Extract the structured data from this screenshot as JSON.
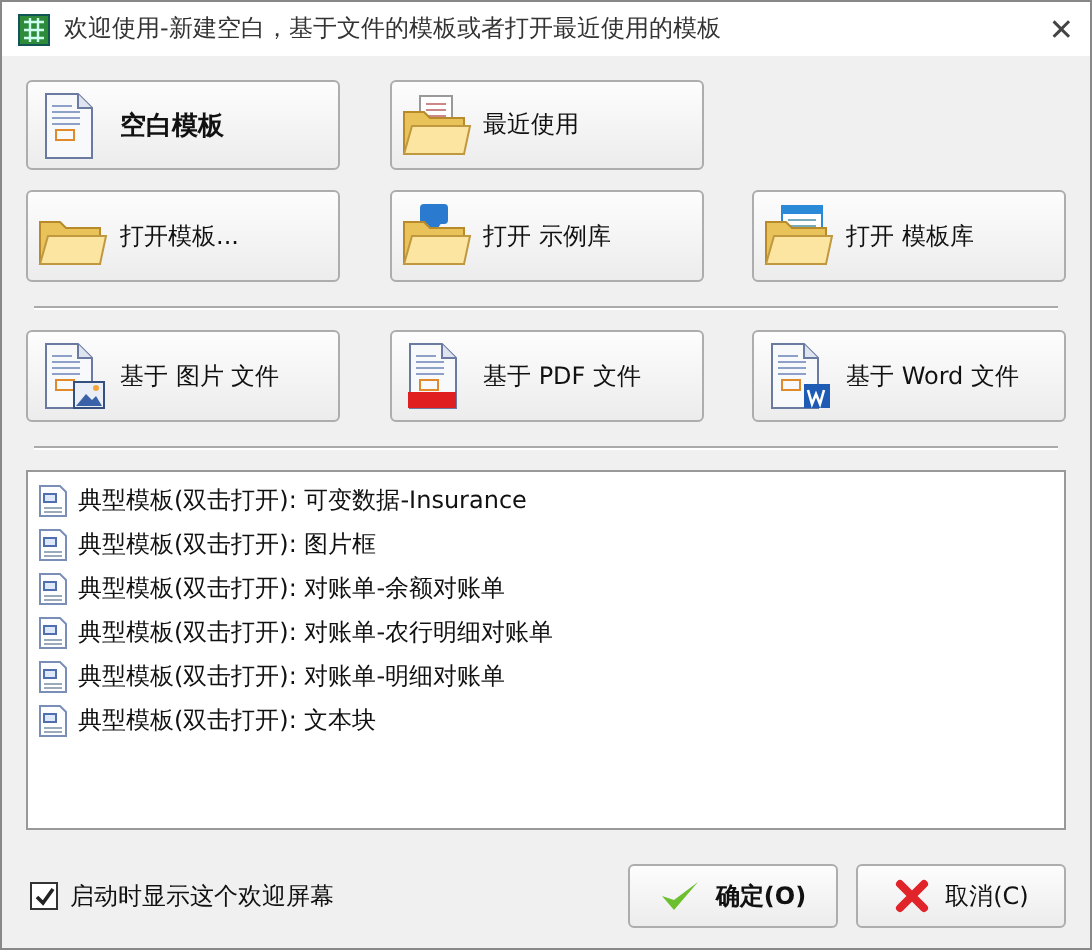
{
  "window": {
    "title": "欢迎使用-新建空白，基于文件的模板或者打开最近使用的模板",
    "close": "✕"
  },
  "button_rows": [
    [
      {
        "label": "空白模板",
        "kind": "blank"
      },
      {
        "label": "最近使用",
        "kind": "recent"
      }
    ],
    [
      {
        "label": "打开模板...",
        "kind": "open"
      },
      {
        "label": "打开 示例库",
        "kind": "samples"
      },
      {
        "label": "打开 模板库",
        "kind": "library"
      }
    ],
    [
      {
        "label": "基于 图片 文件",
        "kind": "image"
      },
      {
        "label": "基于 PDF 文件",
        "kind": "pdf"
      },
      {
        "label": "基于 Word 文件",
        "kind": "word"
      }
    ]
  ],
  "templates": [
    {
      "label": "典型模板(双击打开): 可变数据-Insurance"
    },
    {
      "label": "典型模板(双击打开): 图片框"
    },
    {
      "label": "典型模板(双击打开): 对账单-余额对账单"
    },
    {
      "label": "典型模板(双击打开): 对账单-农行明细对账单"
    },
    {
      "label": "典型模板(双击打开): 对账单-明细对账单"
    },
    {
      "label": "典型模板(双击打开): 文本块"
    }
  ],
  "show_on_startup": {
    "label": "启动时显示这个欢迎屏幕",
    "checked": true
  },
  "buttons": [
    {
      "label": "确定(O)",
      "kind": "ok"
    },
    {
      "label": "取消(C)",
      "kind": "cancel"
    }
  ]
}
